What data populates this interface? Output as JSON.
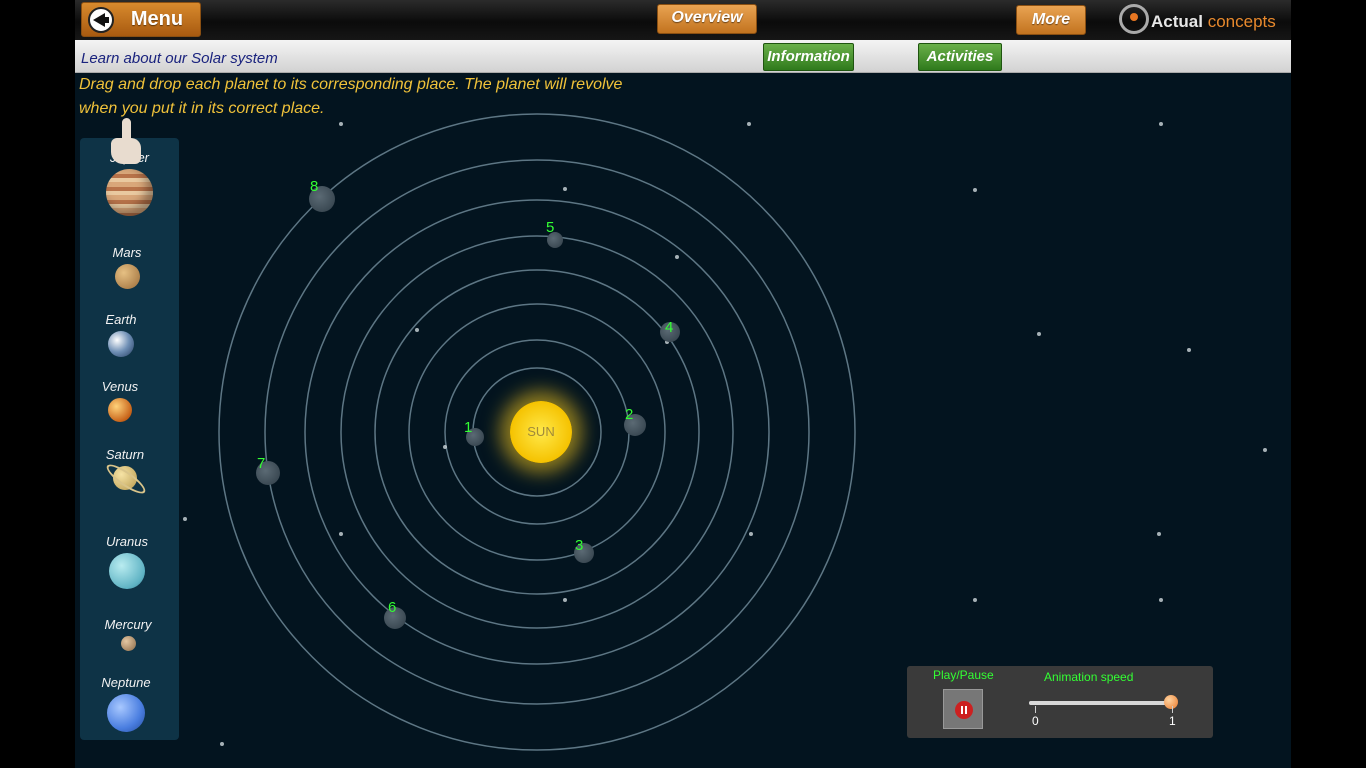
{
  "header": {
    "menu_label": "Menu",
    "overview_label": "Overview",
    "more_label": "More",
    "logo_text": "Actual",
    "logo_text_accent": "concepts"
  },
  "subbar": {
    "subtitle": "Learn about our Solar system",
    "information_label": "Information",
    "activities_label": "Activities"
  },
  "instruction": {
    "line1": "Drag and drop each planet to its corresponding place. The planet will revolve",
    "line2": "when you put it in its correct place."
  },
  "palette": [
    "Jupiter",
    "Mars",
    "Earth",
    "Venus",
    "Saturn",
    "Uranus",
    "Mercury",
    "Neptune"
  ],
  "sun_label": "SUN",
  "slots": [
    "1",
    "2",
    "3",
    "4",
    "5",
    "6",
    "7",
    "8"
  ],
  "controls": {
    "play_pause_label": "Play/Pause",
    "speed_label": "Animation speed",
    "speed_min": "0",
    "speed_max": "1",
    "speed_value": 1
  },
  "colors": {
    "accent_orange": "#d88a2d",
    "accent_green": "#3f8a25",
    "slot_number": "#33ff33",
    "instruction_text": "#f0c23a"
  }
}
